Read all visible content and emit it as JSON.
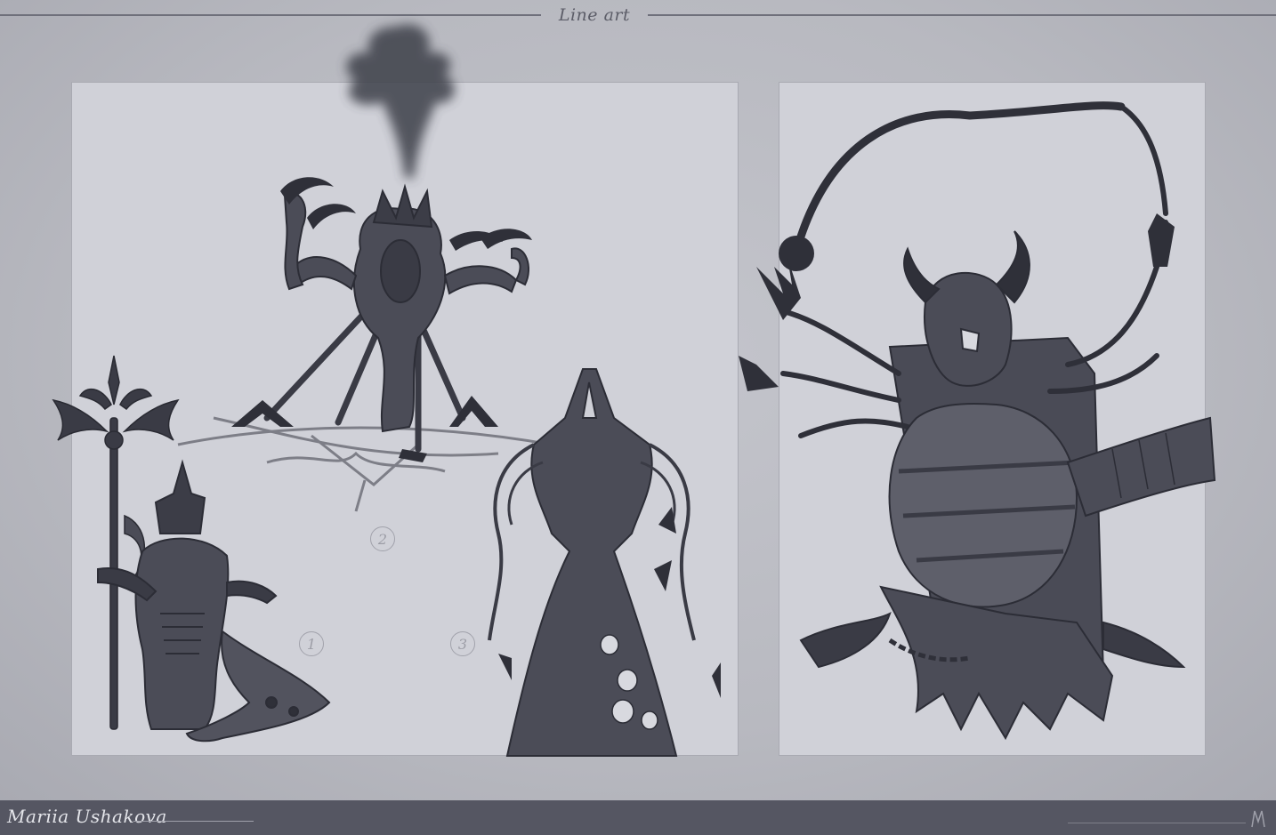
{
  "header": {
    "title": "Line art"
  },
  "labels": {
    "one": "1",
    "two": "2",
    "three": "3"
  },
  "footer": {
    "author": "Mariia Ushakova"
  },
  "colors": {
    "background": "#b9bac1",
    "panel": "#d0d1d8",
    "ink": "#4b4c57",
    "ink_dark": "#2f3039",
    "footer_bar": "#555662",
    "footer_text": "#e4e5ea"
  }
}
